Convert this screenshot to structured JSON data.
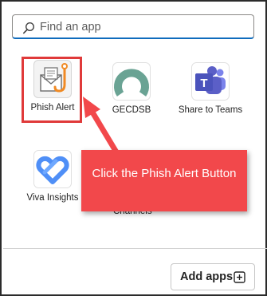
{
  "search": {
    "placeholder": "Find an app"
  },
  "apps": [
    {
      "label": "Phish Alert"
    },
    {
      "label": "GECDSB"
    },
    {
      "label": "Share to Teams"
    },
    {
      "label": "Viva Insights"
    }
  ],
  "partially_hidden_label": "Channels",
  "add_apps": {
    "label": "Add apps"
  },
  "callout": {
    "text": "Click the Phish Alert Button"
  },
  "colors": {
    "highlight": "#e03a3a",
    "callout": "#f2484b",
    "teams": "#5b5fc7",
    "gecdsb": "#6aa394",
    "viva": "#4f8ff7",
    "search_focus": "#0f6cbd"
  },
  "icons": {
    "search": "search-icon",
    "phish": "envelope-hook-icon",
    "gecdsb": "ring-logo-icon",
    "teams": "teams-icon",
    "viva": "viva-insights-icon",
    "add": "plus-square-icon"
  }
}
